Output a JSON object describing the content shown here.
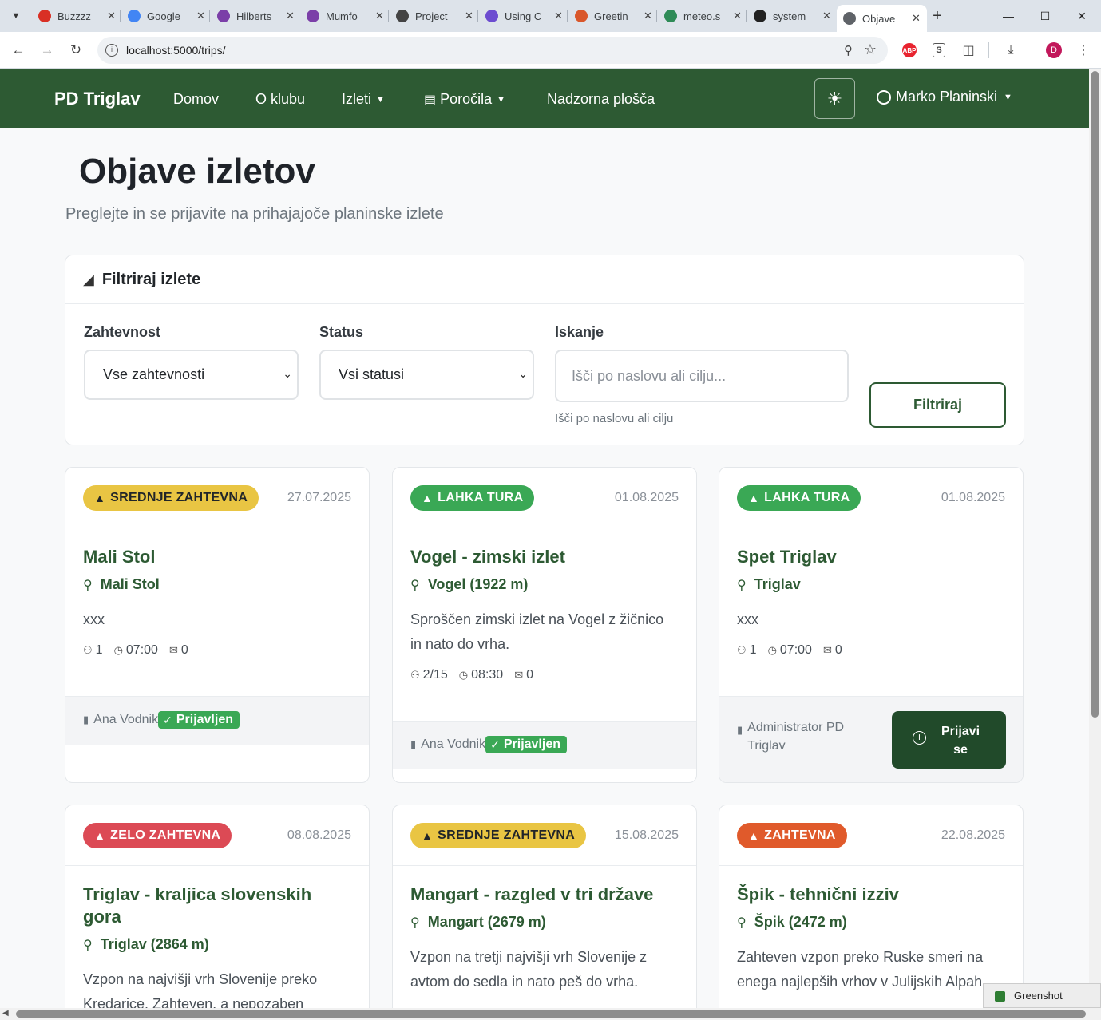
{
  "browser": {
    "tabs": [
      {
        "title": "Buzzzz",
        "favicon_color": "#d93025"
      },
      {
        "title": "Google",
        "favicon_color": "#4285f4"
      },
      {
        "title": "Hilberts",
        "favicon_color": "#7b3fa8"
      },
      {
        "title": "Mumfo",
        "favicon_color": "#7b3fa8"
      },
      {
        "title": "Project",
        "favicon_color": "#444444"
      },
      {
        "title": "Using C",
        "favicon_color": "#6c4cd0"
      },
      {
        "title": "Greetin",
        "favicon_color": "#d9572b"
      },
      {
        "title": "meteo.s",
        "favicon_color": "#2e8b57"
      },
      {
        "title": "system",
        "favicon_color": "#222222"
      },
      {
        "title": "Objave",
        "favicon_color": "#5f6368"
      }
    ],
    "url": "localhost:5000/trips/"
  },
  "navbar": {
    "brand": "PD Triglav",
    "links": [
      "Domov",
      "O klubu",
      "Izleti",
      "Poročila",
      "Nadzorna plošča"
    ],
    "user": "Marko Planinski"
  },
  "page": {
    "title": "Objave izletov",
    "subtitle": "Preglejte in se prijavite na prihajajoče planinske izlete"
  },
  "filter": {
    "title": "Filtriraj izlete",
    "difficulty_label": "Zahtevnost",
    "difficulty_value": "Vse zahtevnosti",
    "status_label": "Status",
    "status_value": "Vsi statusi",
    "search_label": "Iskanje",
    "search_placeholder": "Išči po naslovu ali cilju...",
    "search_help": "Išči po naslovu ali cilju",
    "button": "Filtriraj"
  },
  "trips": [
    {
      "badge": "SREDNJE ZAHTEVNA",
      "date": "27.07.2025",
      "title": "Mali Stol",
      "location": "Mali Stol",
      "description": "xxx",
      "participants": "1",
      "time": "07:00",
      "comments": "0",
      "organizer": "Ana Vodnik",
      "status": "Prijavljen"
    },
    {
      "badge": "LAHKA TURA",
      "date": "01.08.2025",
      "title": "Vogel - zimski izlet",
      "location": "Vogel (1922 m)",
      "description": "Sproščen zimski izlet na Vogel z žičnico in nato do vrha.",
      "participants": "2/15",
      "time": "08:30",
      "comments": "0",
      "organizer": "Ana Vodnik",
      "status": "Prijavljen"
    },
    {
      "badge": "LAHKA TURA",
      "date": "01.08.2025",
      "title": "Spet Triglav",
      "location": "Triglav",
      "description": "xxx",
      "participants": "1",
      "time": "07:00",
      "comments": "0",
      "organizer": "Administrator PD Triglav",
      "action": "Prijavi se"
    },
    {
      "badge": "ZELO ZAHTEVNA",
      "date": "08.08.2025",
      "title": "Triglav - kraljica slovenskih gora",
      "location": "Triglav (2864 m)",
      "description": "Vzpon na najvišji vrh Slovenije preko Kredarice. Zahteven, a nepozaben"
    },
    {
      "badge": "SREDNJE ZAHTEVNA",
      "date": "15.08.2025",
      "title": "Mangart - razgled v tri države",
      "location": "Mangart (2679 m)",
      "description": "Vzpon na tretji najvišji vrh Slovenije z avtom do sedla in nato peš do vrha."
    },
    {
      "badge": "ZAHTEVNA",
      "date": "22.08.2025",
      "title": "Špik - tehnični izziv",
      "location": "Špik (2472 m)",
      "description": "Zahteven vzpon preko Ruske smeri na enega najlepših vrhov v Julijskih Alpah."
    }
  ],
  "taskbar": {
    "greenshot": "Greenshot"
  }
}
